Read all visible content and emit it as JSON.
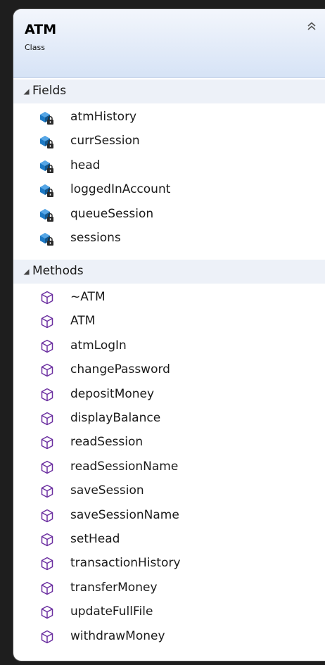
{
  "class_box": {
    "title": "ATM",
    "subtitle": "Class",
    "collapse_icon": "double-chevron-up-icon"
  },
  "fields": {
    "label": "Fields",
    "icon": "private-field-icon",
    "items": [
      "atmHistory",
      "currSession",
      "head",
      "loggedInAccount",
      "queueSession",
      "sessions"
    ]
  },
  "methods": {
    "label": "Methods",
    "icon": "method-cube-icon",
    "items": [
      "~ATM",
      "ATM",
      "atmLogIn",
      "changePassword",
      "depositMoney",
      "displayBalance",
      "readSession",
      "readSessionName",
      "saveSession",
      "saveSessionName",
      "setHead",
      "transactionHistory",
      "transferMoney",
      "updateFullFile",
      "withdrawMoney"
    ]
  },
  "colors": {
    "header_top": "#f3f6fc",
    "header_bottom": "#d6e3f6",
    "section_bg": "#edf1f8",
    "field_icon": "#1d79c4",
    "method_icon": "#6b2fa0"
  }
}
